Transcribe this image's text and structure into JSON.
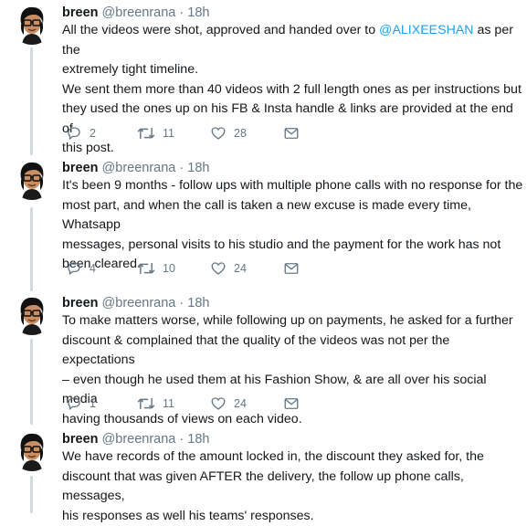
{
  "tweets": [
    {
      "author_name": "breen",
      "author_handle": "@breenrana",
      "separator": "·",
      "time": "18h",
      "text_before": "All the videos were shot, approved and handed over to ",
      "mention": "@ALIXEESHAN",
      "text_after": " as per the\nextremely tight timeline.\nWe sent them more than 40 videos with 2 full length ones as per instructions but\nthey used the ones up on his FB & Insta handle & links are provided at the end of\nthis post.",
      "replies": "2",
      "retweets": "11",
      "likes": "28"
    },
    {
      "author_name": "breen",
      "author_handle": "@breenrana",
      "separator": "·",
      "time": "18h",
      "text": "It's been 9 months - follow ups with multiple phone calls with no response for the\nmost part, and when the call is taken a new excuse is made every time, Whatsapp\nmessages, personal visits to his studio and the payment for the work has not\nbeen cleared.",
      "replies": "4",
      "retweets": "10",
      "likes": "24"
    },
    {
      "author_name": "breen",
      "author_handle": "@breenrana",
      "separator": "·",
      "time": "18h",
      "text": "To make matters worse, while following up on payments, he asked for a further\ndiscount & complained that the quality of the videos was not per the expectations\n– even though he used them at his Fashion Show, & are all over his social media\nhaving thousands of views on each video.",
      "replies": "1",
      "retweets": "11",
      "likes": "24"
    },
    {
      "author_name": "breen",
      "author_handle": "@breenrana",
      "separator": "·",
      "time": "18h",
      "text": "We have records of the amount locked in, the discount they asked for, the\ndiscount that was given AFTER the delivery, the follow up phone calls, messages,\nhis responses as well his teams' responses."
    }
  ],
  "icons": {
    "reply": "reply-icon",
    "retweet": "retweet-icon",
    "like": "heart-icon",
    "dm": "envelope-icon",
    "avatar": "cartoon-avatar-icon"
  },
  "colors": {
    "text": "#14171a",
    "muted": "#657786",
    "link": "#1da1f2",
    "thread_line": "#cfd9de"
  }
}
